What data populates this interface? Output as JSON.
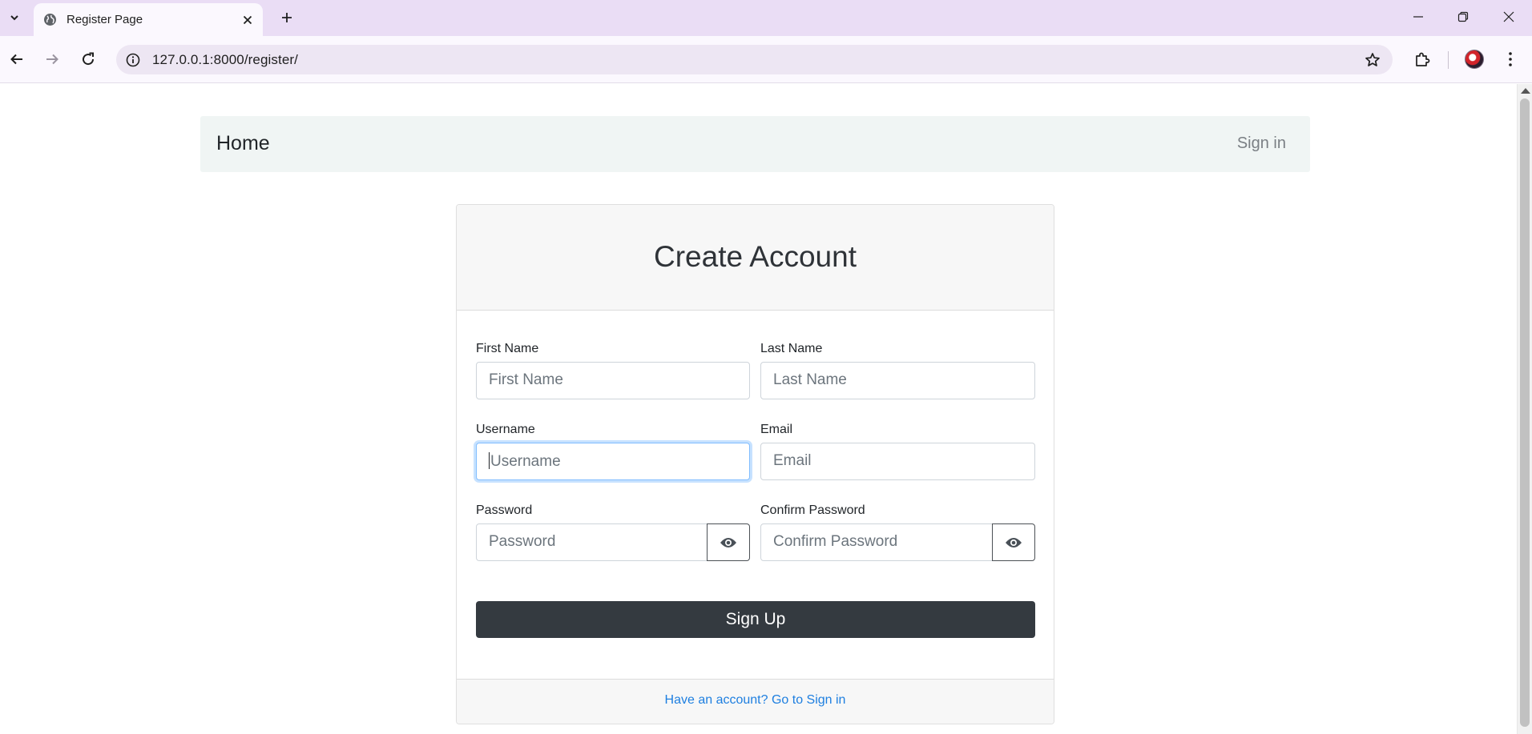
{
  "browser": {
    "tab_title": "Register Page",
    "url": "127.0.0.1:8000/register/"
  },
  "navbar": {
    "brand": "Home",
    "signin": "Sign in"
  },
  "card": {
    "title": "Create Account",
    "fields": {
      "first_name": {
        "label": "First Name",
        "placeholder": "First Name",
        "value": ""
      },
      "last_name": {
        "label": "Last Name",
        "placeholder": "Last Name",
        "value": ""
      },
      "username": {
        "label": "Username",
        "placeholder": "Username",
        "value": ""
      },
      "email": {
        "label": "Email",
        "placeholder": "Email",
        "value": ""
      },
      "password": {
        "label": "Password",
        "placeholder": "Password",
        "value": ""
      },
      "confirm_password": {
        "label": "Confirm Password",
        "placeholder": "Confirm Password",
        "value": ""
      }
    },
    "submit_label": "Sign Up",
    "footer_link": "Have an account? Go to Sign in"
  },
  "colors": {
    "tab_strip": "#eaddf5",
    "navbar_bg": "#f0f5f4",
    "button_dark": "#343a40",
    "link_blue": "#1e7fe0",
    "focus_ring": "#80bdff"
  },
  "icons": {
    "favicon": "globe-icon",
    "password_toggle": "eye-icon"
  }
}
